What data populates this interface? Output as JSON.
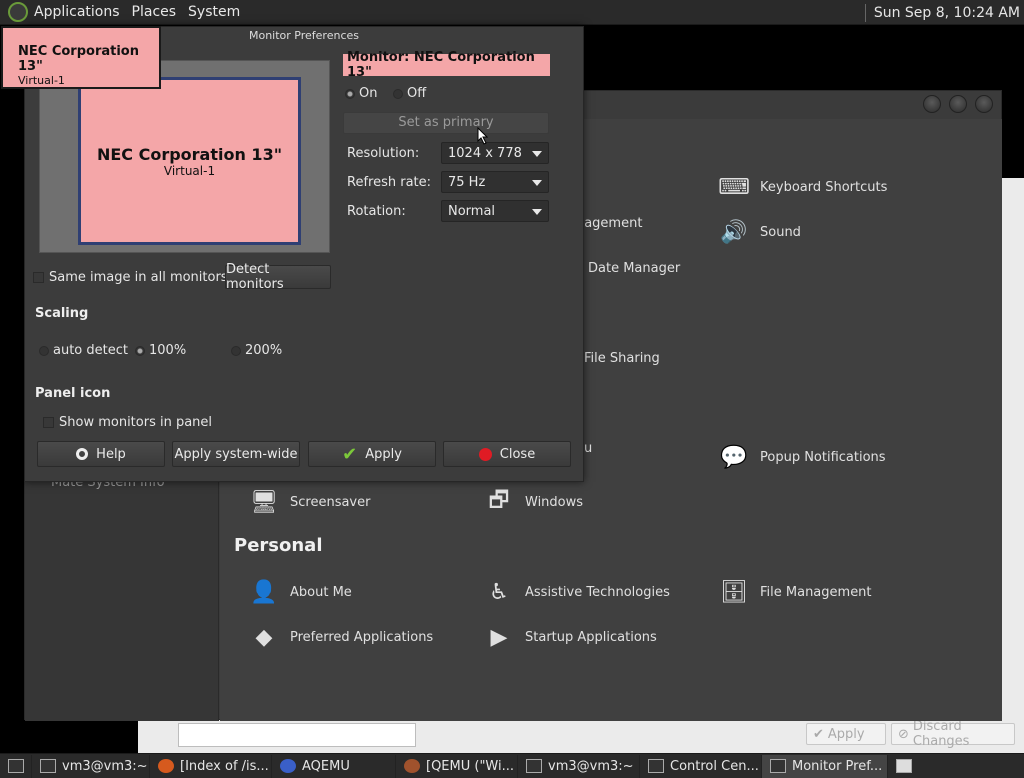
{
  "top_panel": {
    "menus": [
      "Applications",
      "Places",
      "System"
    ],
    "clock": "Sun Sep  8, 10:24 AM"
  },
  "monitor_prefs": {
    "title": "Monitor Preferences",
    "preview_monitor_name": "NEC Corporation 13\"",
    "preview_monitor_port": "Virtual-1",
    "monitor_label": "Monitor: NEC Corporation 13\"",
    "power_on": "On",
    "power_off": "Off",
    "set_primary": "Set as primary",
    "resolution_label": "Resolution:",
    "resolution_value": "1024 x 778",
    "refresh_label": "Refresh rate:",
    "refresh_value": "75 Hz",
    "rotation_label": "Rotation:",
    "rotation_value": "Normal",
    "same_image": "Same image in all monitors",
    "detect": "Detect monitors",
    "scaling_header": "Scaling",
    "scale_auto": "auto detect",
    "scale_100": "100%",
    "scale_200": "200%",
    "panel_icon_header": "Panel icon",
    "show_monitors": "Show monitors in panel",
    "btn_help": "Help",
    "btn_apply_system": "Apply system-wide",
    "btn_apply": "Apply",
    "btn_close": "Close"
  },
  "tooltip": {
    "name": "NEC Corporation 13\"",
    "port": "Virtual-1"
  },
  "control_center": {
    "sidebar_item": "Mate System Info",
    "items": {
      "keyboard_shortcuts": "Keyboard Shortcuts",
      "management": "anagement",
      "sound": "Sound",
      "date_manager": "Date Manager",
      "file_sharing": "File Sharing",
      "popup_notifications": "Popup Notifications",
      "partial_u": "u",
      "screensaver": "Screensaver",
      "windows": "Windows",
      "about_me": "About Me",
      "assistive": "Assistive Technologies",
      "file_management": "File Management",
      "preferred_apps": "Preferred Applications",
      "startup_apps": "Startup Applications"
    },
    "personal_header": "Personal"
  },
  "back_window": {
    "apply": "Apply",
    "discard": "Discard Changes"
  },
  "taskbar": {
    "tasks": [
      "vm3@vm3:~",
      "[Index of /is...",
      "AQEMU",
      "[QEMU (\"Wi...",
      "vm3@vm3:~",
      "Control Cen...",
      "Monitor Pref..."
    ]
  },
  "colors": {
    "monitor_pink": "#f4a6a8",
    "monitor_border": "#2f3f73"
  }
}
